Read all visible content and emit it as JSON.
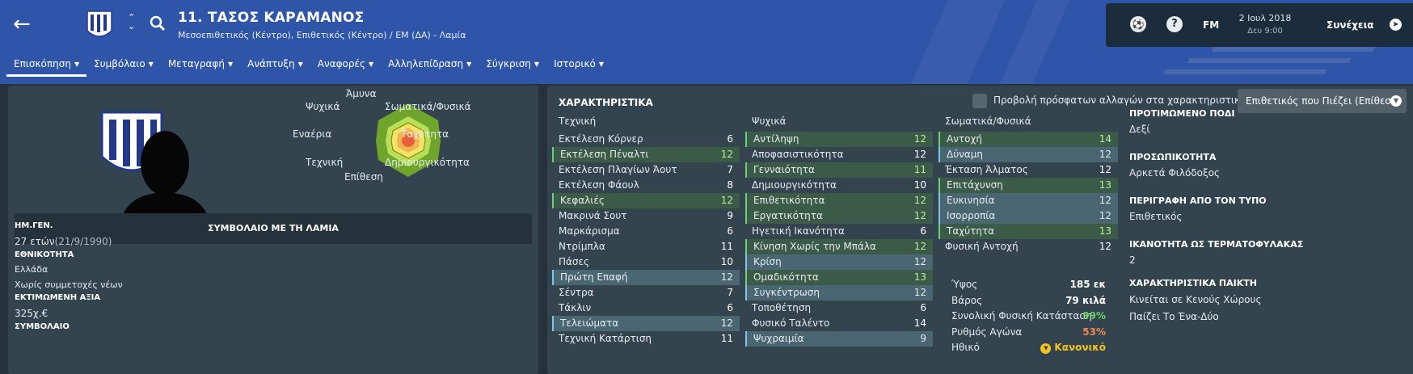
{
  "header": {
    "player_name": "11. ΤΑΣΟΣ ΚΑΡΑΜΑΝΟΣ",
    "positions": "Μεσοεπιθετικός (Κέντρο), Επιθετικός (Κέντρο) / ΕΜ (ΔΑ) - Λαμία",
    "back_icon": "arrow-left-icon",
    "search_icon": "search-icon",
    "brand_color": "#2f55a8"
  },
  "nav": {
    "tabs": [
      {
        "label": "Επισκόπηση",
        "active": true
      },
      {
        "label": "Συμβόλαιο"
      },
      {
        "label": "Μεταγραφή"
      },
      {
        "label": "Ανάπτυξη"
      },
      {
        "label": "Αναφορές"
      },
      {
        "label": "Αλληλεπίδραση"
      },
      {
        "label": "Σύγκριση"
      },
      {
        "label": "Ιστορικό"
      }
    ]
  },
  "topbar": {
    "fm_label": "FM",
    "date": "2 Ιουλ 2018",
    "time": "Δευ 9:00",
    "continue_label": "Συνέχεια",
    "help_glyph": "?"
  },
  "overview": {
    "radar_labels": {
      "top": "Άμυνα",
      "upper_left": "Ψυχικά",
      "upper_right": "Σωματικά/Φυσικά",
      "left": "Εναέρια",
      "right": "Ταχύτητα",
      "lower_left": "Τεχνική",
      "lower_right": "Δημιουργικότητα",
      "bottom": "Επίθεση"
    },
    "contract_banner": "ΣΥΜΒΟΛΑΙΟ ΜΕ ΤΗ ΛΑΜΙΑ",
    "dob_label": "ΗΜ.ΓΕΝ.",
    "age": "27 ετών",
    "dob": "(21/9/1990)",
    "nationality_label": "ΕΘΝΙΚΟΤΗΤΑ",
    "nationality": "Ελλάδα",
    "youth_caps": "Χωρίς συμμετοχές νέων",
    "value_label": "ΕΚΤΙΜΩΜΕΝΗ ΑΞΙΑ",
    "value": "325χ.€",
    "contract_label": "ΣΥΜΒΟΛΑΙΟ"
  },
  "attributes": {
    "title": "ΧΑΡΑΚΤΗΡΙΣΤΙΚΑ",
    "toggle_label": "Προβολή πρόσφατων αλλαγών στα χαρακτηριστικά",
    "role_select": "Επιθετικός που Πιέζει (Επίθεση)",
    "technical_header": "Τεχνική",
    "mental_header": "Ψυχικά",
    "physical_header": "Σωματικά/Φυσικά",
    "technical": [
      {
        "name": "Εκτέλεση Κόρνερ",
        "value": "6",
        "hl": ""
      },
      {
        "name": "Εκτέλεση Πέναλτι",
        "value": "12",
        "hl": "gr"
      },
      {
        "name": "Εκτέλεση Πλαγίων Άουτ",
        "value": "7",
        "hl": ""
      },
      {
        "name": "Εκτέλεση Φάουλ",
        "value": "8",
        "hl": ""
      },
      {
        "name": "Κεφαλιές",
        "value": "12",
        "hl": "gr"
      },
      {
        "name": "Μακρινά Σουτ",
        "value": "9",
        "hl": ""
      },
      {
        "name": "Μαρκάρισμα",
        "value": "6",
        "hl": ""
      },
      {
        "name": "Ντρίμπλα",
        "value": "11",
        "hl": ""
      },
      {
        "name": "Πάσες",
        "value": "10",
        "hl": ""
      },
      {
        "name": "Πρώτη Επαφή",
        "value": "12",
        "hl": "hl"
      },
      {
        "name": "Σέντρα",
        "value": "7",
        "hl": ""
      },
      {
        "name": "Τάκλιν",
        "value": "6",
        "hl": ""
      },
      {
        "name": "Τελειώματα",
        "value": "12",
        "hl": "hl"
      },
      {
        "name": "Τεχνική Κατάρτιση",
        "value": "11",
        "hl": ""
      }
    ],
    "mental": [
      {
        "name": "Αντίληψη",
        "value": "12",
        "hl": "gr"
      },
      {
        "name": "Αποφασιστικότητα",
        "value": "12",
        "hl": ""
      },
      {
        "name": "Γενναιότητα",
        "value": "11",
        "hl": "gr"
      },
      {
        "name": "Δημιουργικότητα",
        "value": "10",
        "hl": ""
      },
      {
        "name": "Επιθετικότητα",
        "value": "12",
        "hl": "gr"
      },
      {
        "name": "Εργατικότητα",
        "value": "12",
        "hl": "gr"
      },
      {
        "name": "Ηγετική Ικανότητα",
        "value": "6",
        "hl": ""
      },
      {
        "name": "Κίνηση Χωρίς την Μπάλα",
        "value": "12",
        "hl": "gr"
      },
      {
        "name": "Κρίση",
        "value": "12",
        "hl": "hl"
      },
      {
        "name": "Ομαδικότητα",
        "value": "13",
        "hl": "gr"
      },
      {
        "name": "Συγκέντρωση",
        "value": "12",
        "hl": "hl"
      },
      {
        "name": "Τοποθέτηση",
        "value": "6",
        "hl": ""
      },
      {
        "name": "Φυσικό Ταλέντο",
        "value": "14",
        "hl": ""
      },
      {
        "name": "Ψυχραιμία",
        "value": "9",
        "hl": "hl"
      }
    ],
    "physical": [
      {
        "name": "Αντοχή",
        "value": "14",
        "hl": "gr"
      },
      {
        "name": "Δύναμη",
        "value": "12",
        "hl": "hl"
      },
      {
        "name": "Έκταση Άλματος",
        "value": "12",
        "hl": ""
      },
      {
        "name": "Επιτάχυνση",
        "value": "13",
        "hl": "gr"
      },
      {
        "name": "Ευκινησία",
        "value": "12",
        "hl": "hl"
      },
      {
        "name": "Ισορροπία",
        "value": "12",
        "hl": "hl"
      },
      {
        "name": "Ταχύτητα",
        "value": "13",
        "hl": "gr"
      },
      {
        "name": "Φυσική Αντοχή",
        "value": "12",
        "hl": ""
      }
    ],
    "stats": [
      {
        "name": "Ύψος",
        "value": "185 εκ",
        "color": "#ffffff"
      },
      {
        "name": "Βάρος",
        "value": "79 κιλά",
        "color": "#ffffff"
      },
      {
        "name": "Συνολική Φυσική Κατάσταση",
        "value": "99%",
        "color": "#6cd36b"
      },
      {
        "name": "Ρυθμός Αγώνα",
        "value": "53%",
        "color": "#f08a50"
      },
      {
        "name": "Ηθικό",
        "value": "Κανονικό",
        "color": "#f3c21c"
      }
    ]
  },
  "side": {
    "foot_label": "ΠΡΟΤΙΜΩΜΕΝΟ ΠΟΔΙ",
    "foot": "Δεξί",
    "personality_label": "ΠΡΟΣΩΠΙΚΟΤΗΤΑ",
    "personality": "Αρκετά Φιλόδοξος",
    "media_label": "ΠΕΡΙΓΡΑΦΗ ΑΠΟ ΤΟΝ ΤΥΠΟ",
    "media": "Επιθετικός",
    "gk_label": "ΙΚΑΝΟΤΗΤΑ ΩΣ ΤΕΡΜΑΤΟΦΥΛΑΚΑΣ",
    "gk": "2",
    "traits_label": "ΧΑΡΑΚΤΗΡΙΣΤΙΚΑ ΠΑΙΚΤΗ",
    "traits": [
      "Κινείται σε Κενούς Χώρους",
      "Παίζει Το Ένα-Δύο"
    ]
  }
}
